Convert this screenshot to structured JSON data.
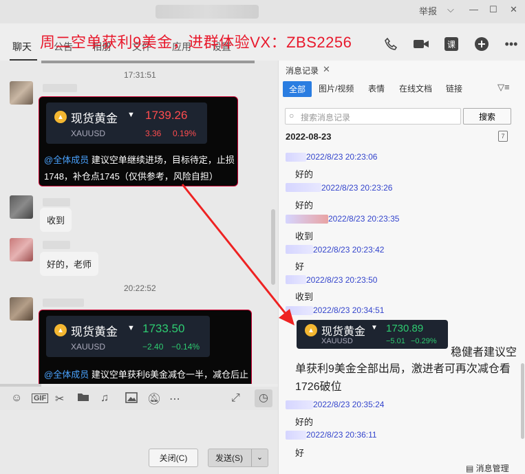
{
  "titlebar": {
    "report": "举报",
    "minimize": "—",
    "maximize": "☐",
    "close": "✕"
  },
  "overlay_title": "周二空单获利9美金，进群体验VX：ZBS2256",
  "nav": {
    "tabs": [
      "聊天",
      "公告",
      "相册",
      "文件",
      "应用",
      "设置"
    ]
  },
  "chat": {
    "timestamps": [
      "17:31:51",
      "20:22:52"
    ],
    "card1": {
      "name": "现货黄金",
      "code": "XAUUSD",
      "price": "1739.26",
      "change": "3.36",
      "change_pct": "0.19%",
      "mention": "@全体成员",
      "text": " 建议空单继续进场，目标待定，止损1748，补仓点1745（仅供参考，风险自担）"
    },
    "bubbles": [
      "收到",
      "好的，老师"
    ],
    "card2": {
      "name": "现货黄金",
      "code": "XAUUSD",
      "price": "1733.50",
      "change": "−2.40",
      "change_pct": "−0.14%",
      "mention": "@全体成员",
      "text": " 建议空单获利6美金减仓一半，减仓后止"
    }
  },
  "input": {
    "close_label": "关闭(C)",
    "send_label": "发送(S)"
  },
  "history": {
    "title": "消息记录",
    "filters": [
      "全部",
      "图片/视频",
      "表情",
      "在线文档",
      "链接"
    ],
    "search_placeholder": "搜索消息记录",
    "search_button": "搜索",
    "date": "2022-08-23",
    "records": [
      {
        "time": "2022/8/23 20:23:06",
        "text": "好的"
      },
      {
        "time": "2022/8/23 20:23:26",
        "text": "好的"
      },
      {
        "time": "2022/8/23 20:23:35",
        "text": "收到"
      },
      {
        "time": "2022/8/23 20:23:42",
        "text": "好"
      },
      {
        "time": "2022/8/23 20:23:50",
        "text": "收到"
      },
      {
        "time": "2022/8/23 20:34:51",
        "text": ""
      },
      {
        "time": "2022/8/23 20:35:24",
        "text": "好的"
      },
      {
        "time": "2022/8/23 20:36:11",
        "text": "好"
      }
    ],
    "card": {
      "name": "现货黄金",
      "code": "XAUUSD",
      "price": "1730.89",
      "change": "−5.01",
      "change_pct": "−0.29%"
    },
    "long_text_tail": "稳健者建议空",
    "long_text": "单获利9美金全部出局，激进者可再次减仓看1726破位",
    "manage": "消息管理"
  }
}
